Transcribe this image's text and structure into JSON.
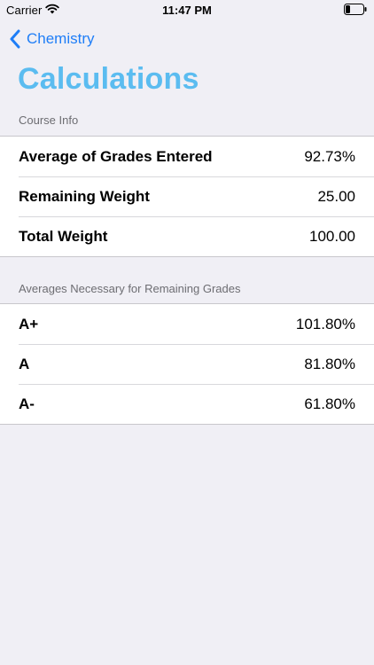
{
  "status_bar": {
    "carrier": "Carrier",
    "time": "11:47 PM",
    "icons": [
      "wifi-icon",
      "battery-icon"
    ]
  },
  "nav": {
    "back_label": "Chemistry",
    "back_icon": "chevron-left-icon",
    "title": "Calculations"
  },
  "sections": [
    {
      "header": "Course Info",
      "rows": [
        {
          "label": "Average of Grades Entered",
          "value": "92.73%"
        },
        {
          "label": "Remaining Weight",
          "value": "25.00"
        },
        {
          "label": "Total Weight",
          "value": "100.00"
        }
      ]
    },
    {
      "header": "Averages Necessary for Remaining Grades",
      "rows": [
        {
          "label": "A+",
          "value": "101.80%"
        },
        {
          "label": "A",
          "value": "81.80%"
        },
        {
          "label": "A-",
          "value": "61.80%"
        }
      ]
    }
  ],
  "colors": {
    "accent": "#1f7ef7",
    "title": "#5bbcf0",
    "background": "#f0eff5"
  }
}
